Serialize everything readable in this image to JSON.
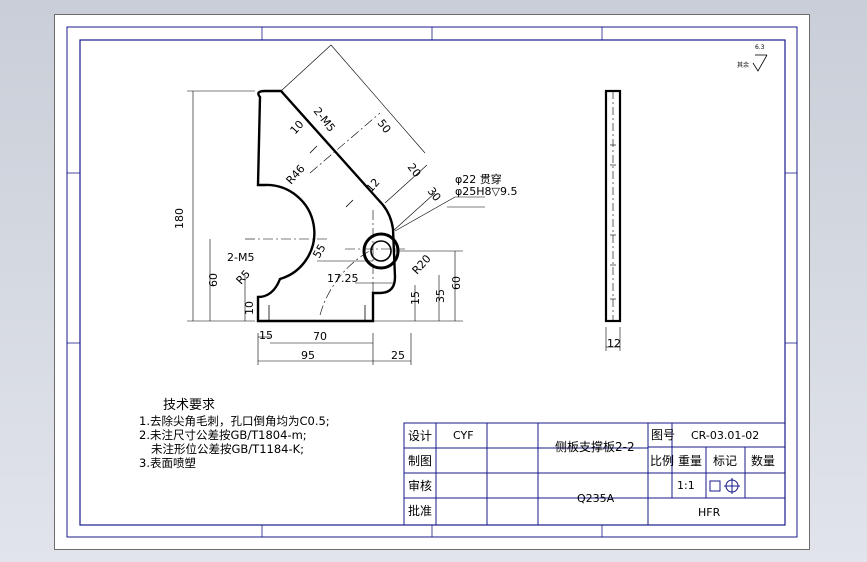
{
  "technical_requirements": {
    "title": "技术要求",
    "items": [
      "1.去除尖角毛刺，孔口倒角均为C0.5;",
      "2.未注尺寸公差按GB/T1804-m;",
      "未注形位公差按GB/T1184-K;",
      "3.表面喷塑"
    ]
  },
  "surface_finish": {
    "label": "其余",
    "value": "6.3"
  },
  "dimensions": {
    "hole": "φ22 贯穿",
    "counterbore": "φ25H8▽9.5",
    "d_180": "180",
    "d_2m5_top": "2-M5",
    "d_50": "50",
    "d_10_top": "10",
    "d_20": "20",
    "d_30": "30",
    "d_12_slot": "12",
    "d_r46": "R46",
    "d_55": "55",
    "d_r5": "R5",
    "d_2m5_bottom": "2-M5",
    "d_60_left": "60",
    "d_10_left": "10",
    "d_15_bottom": "15",
    "d_70": "70",
    "d_95": "95",
    "d_25": "25",
    "d_17_25": "17.25",
    "d_r20": "R20",
    "d_15_right": "15",
    "d_35": "35",
    "d_60_right": "60",
    "d_12_side": "12"
  },
  "title_block": {
    "design_label": "设计",
    "designer": "CYF",
    "drawing_label": "制图",
    "review_label": "审核",
    "approve_label": "批准",
    "part_name": "侧板支撑板2-2",
    "material": "Q235A",
    "drawing_no_label": "图号",
    "drawing_no": "CR-03.01-02",
    "scale_label": "比例",
    "weight_label": "重量",
    "mark_label": "标记",
    "quantity_label": "数量",
    "scale_value": "1:1",
    "company": "HFR"
  }
}
